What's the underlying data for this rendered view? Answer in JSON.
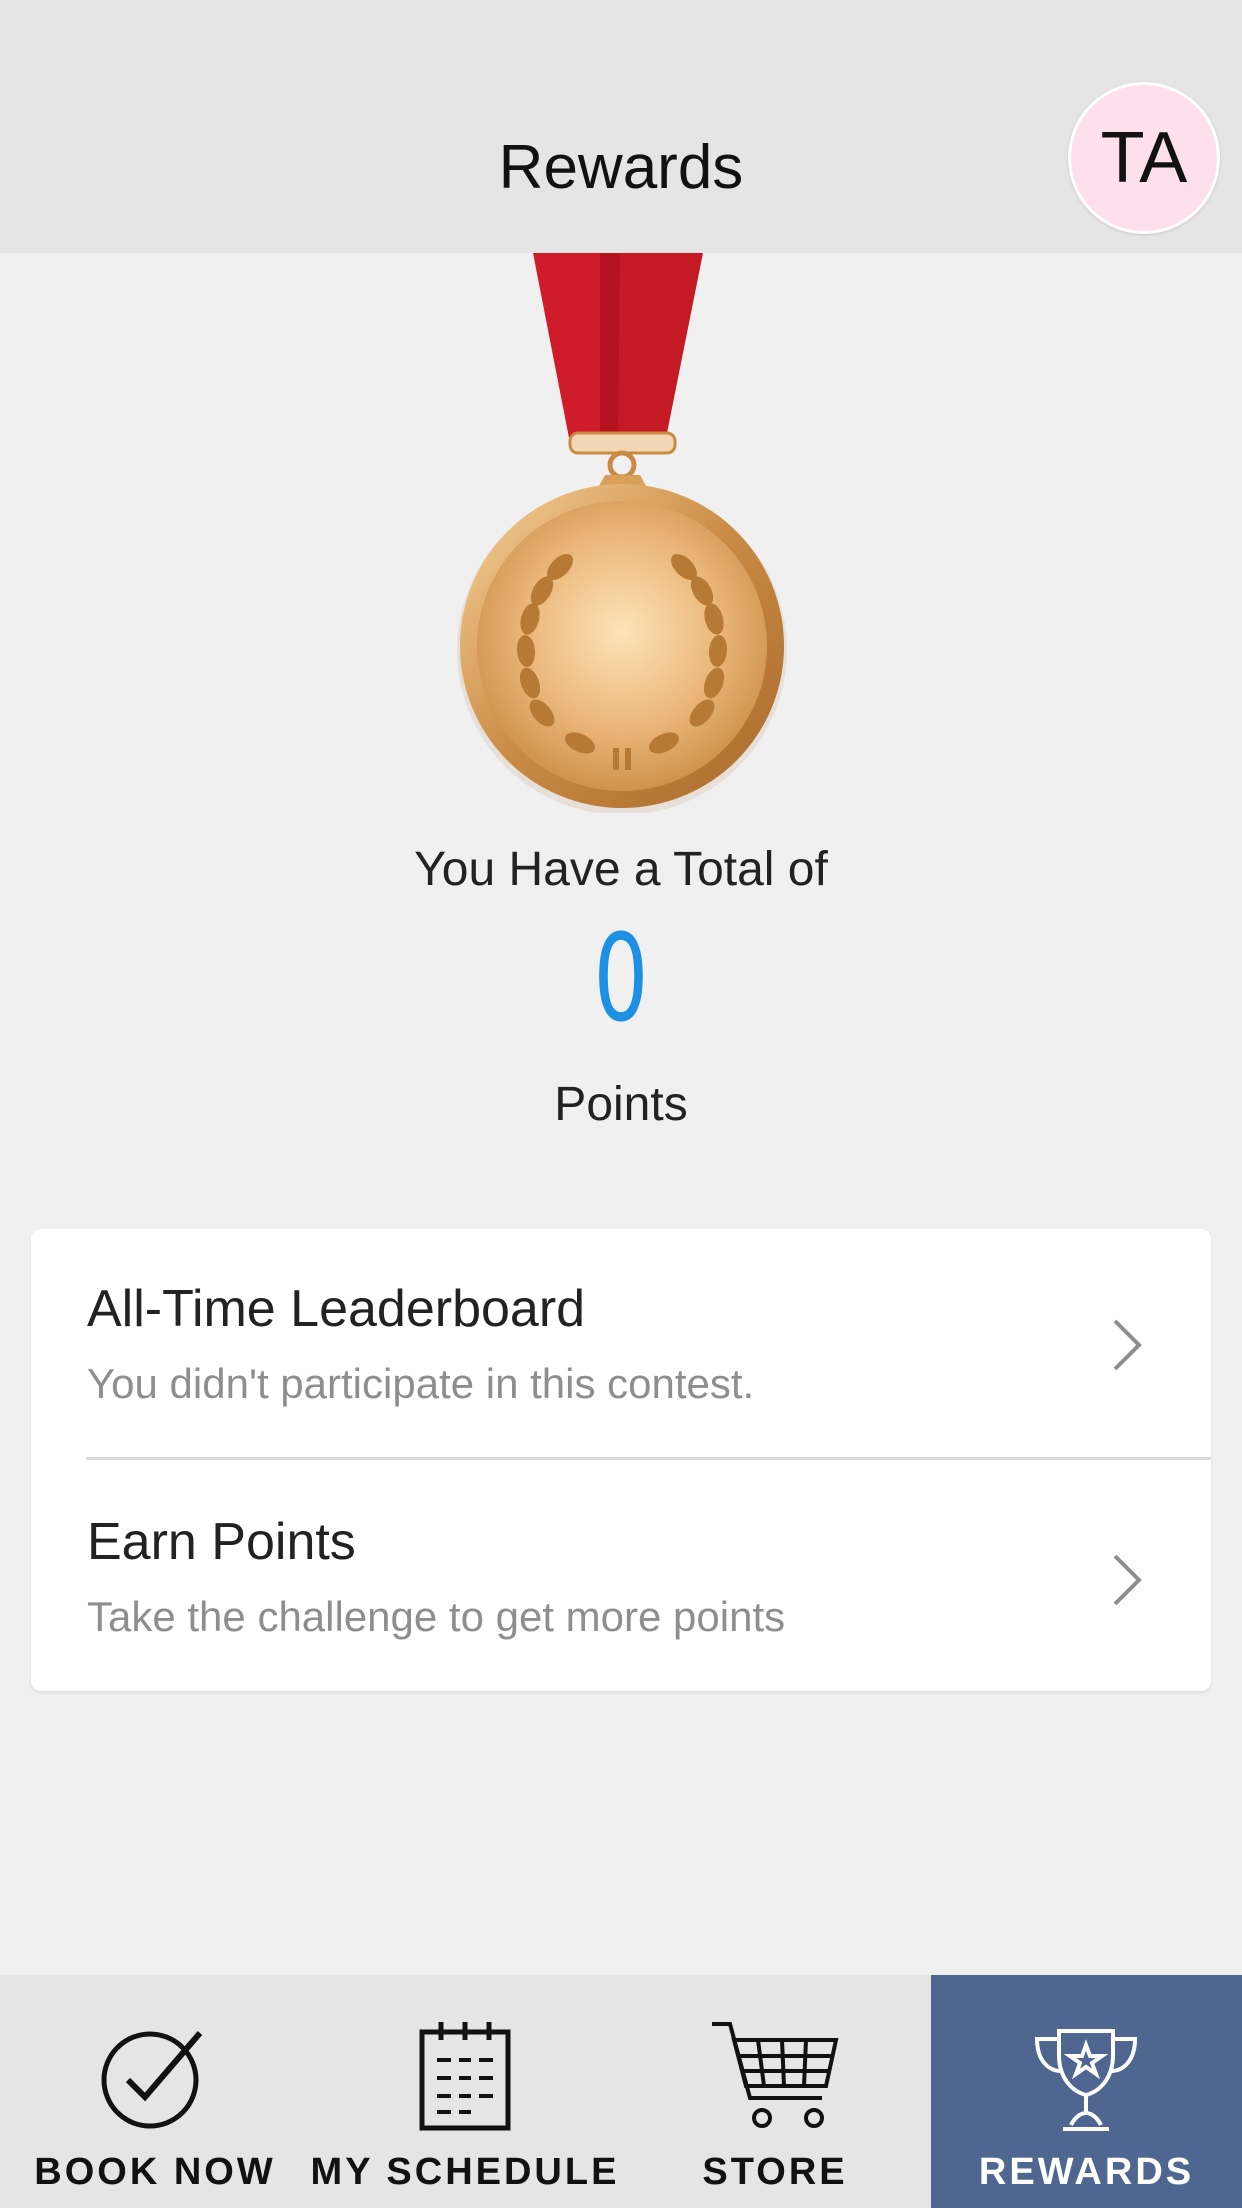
{
  "header": {
    "title": "Rewards",
    "avatar_initials": "TA"
  },
  "summary": {
    "total_label": "You Have a Total of",
    "points_value": "0",
    "points_label": "Points"
  },
  "list": [
    {
      "title": "All-Time Leaderboard",
      "subtitle": "You didn't participate in this contest."
    },
    {
      "title": "Earn Points",
      "subtitle": "Take the challenge to get more points"
    }
  ],
  "tabs": [
    {
      "label": "BOOK NOW",
      "icon": "check-circle-icon",
      "active": false
    },
    {
      "label": "MY SCHEDULE",
      "icon": "calendar-notepad-icon",
      "active": false
    },
    {
      "label": "STORE",
      "icon": "shopping-cart-icon",
      "active": false
    },
    {
      "label": "REWARDS",
      "icon": "trophy-icon",
      "active": true
    }
  ],
  "colors": {
    "accent_blue": "#1e90e3",
    "active_tab": "#4e6690",
    "ribbon_red": "#d01c2a",
    "medal_gold": "#d9a05a",
    "avatar_bg": "#fde0ec"
  }
}
